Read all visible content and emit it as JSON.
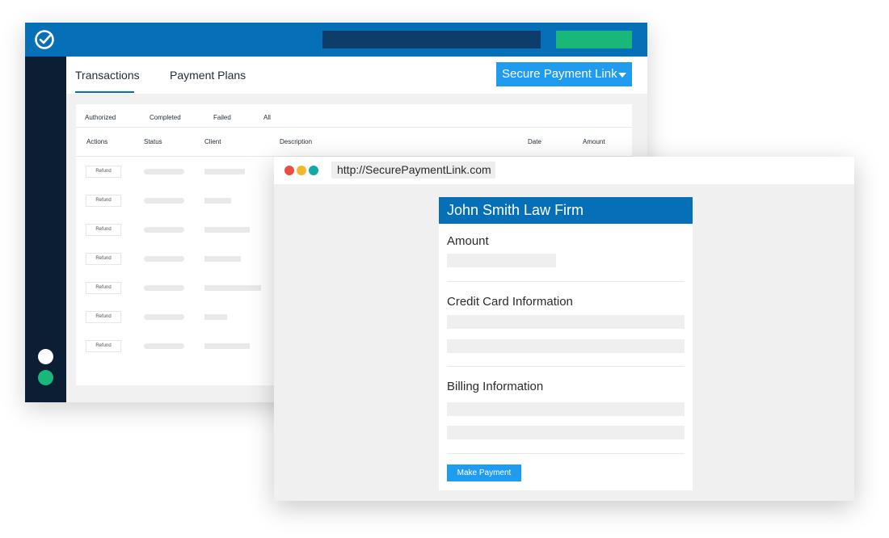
{
  "app": {
    "tabs": [
      {
        "label": "Transactions",
        "active": true
      },
      {
        "label": "Payment Plans",
        "active": false
      }
    ],
    "secure_link_button": "Secure Payment Link",
    "filters": [
      "Authorized",
      "Completed",
      "Failed",
      "All"
    ],
    "columns": [
      "Actions",
      "Status",
      "Client",
      "Description",
      "Date",
      "Amount"
    ],
    "rows": [
      {
        "action": "Refund"
      },
      {
        "action": "Refund"
      },
      {
        "action": "Refund"
      },
      {
        "action": "Refund"
      },
      {
        "action": "Refund"
      },
      {
        "action": "Refund"
      },
      {
        "action": "Refund"
      }
    ],
    "colors": {
      "brand_blue": "#0570b8",
      "sidebar": "#0b1e33",
      "accent_green": "#19b77a",
      "button_blue": "#1f9cf0"
    }
  },
  "browser": {
    "url": "http://SecurePaymentLink.com",
    "card": {
      "title": "John Smith Law Firm",
      "sections": {
        "amount": "Amount",
        "credit_card": "Credit Card Information",
        "billing": "Billing Information"
      },
      "submit_label": "Make Payment"
    }
  }
}
